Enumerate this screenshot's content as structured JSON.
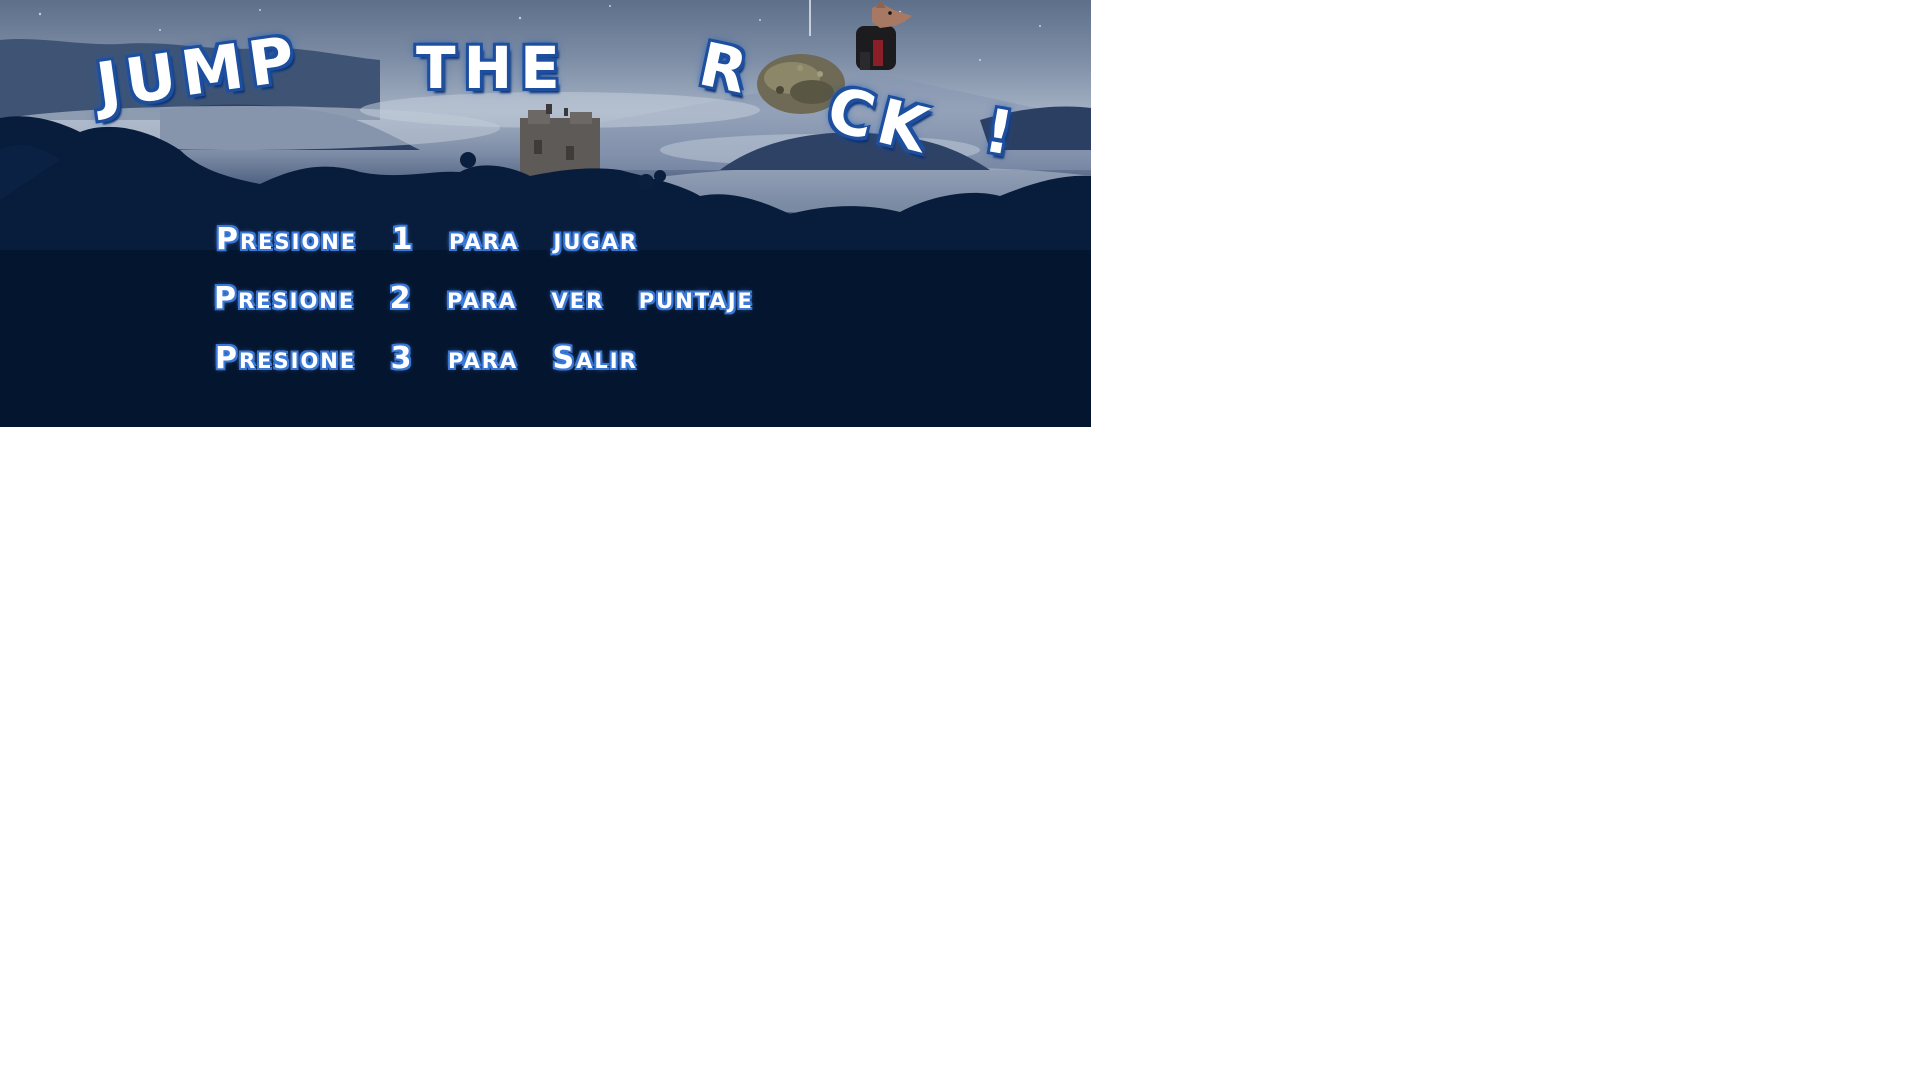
{
  "game": {
    "title": {
      "word1": "JUMP",
      "word2": "THE",
      "word3_start": "R",
      "word3_end": "CK",
      "exclamation": "!"
    },
    "menu": {
      "option_1": "Presione 1 para jugar",
      "option_2": "Presione 2 para ver puntaje",
      "option_3": "Presione 3 para Salir"
    }
  },
  "colors": {
    "sky_top": "#5e6f8a",
    "fog": "#a3b0c3",
    "ground": "#031330",
    "title_outline": "#1d4f9e",
    "menu_outline": "#3a78d8"
  },
  "icons": {
    "rock": "boulder-sprite",
    "player": "wolf-character-sprite",
    "castle": "castle-on-hill"
  }
}
